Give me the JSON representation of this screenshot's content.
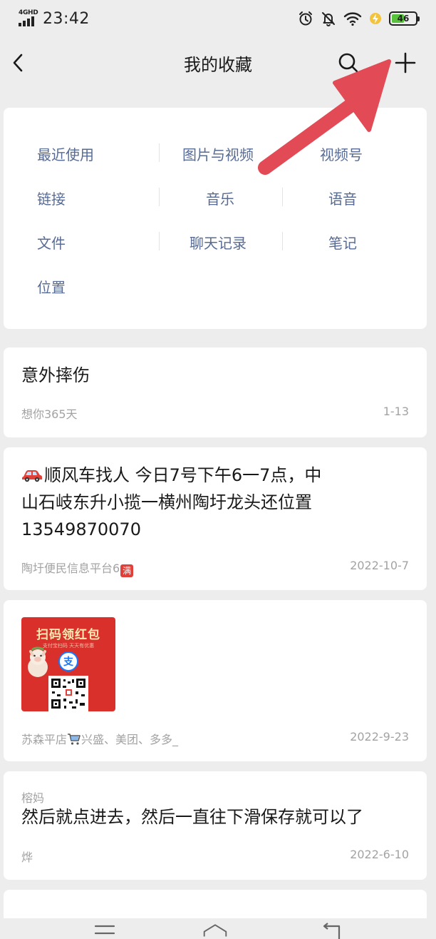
{
  "status_bar": {
    "network": "4GHD",
    "time": "23:42",
    "battery": "46",
    "battery_level": 0.46,
    "icons": [
      "alarm-icon",
      "mute-bell-icon",
      "wifi-icon",
      "charging-icon",
      "battery-icon"
    ]
  },
  "nav": {
    "title": "我的收藏",
    "back_icon": "chevron-left-icon",
    "search_icon": "search-icon",
    "add_icon": "plus-icon"
  },
  "categories": [
    "最近使用",
    "图片与视频",
    "视频号",
    "链接",
    "音乐",
    "语音",
    "文件",
    "聊天记录",
    "笔记",
    "位置"
  ],
  "favorites": [
    {
      "title": "意外摔伤",
      "source": "想你365天",
      "date": "1-13"
    },
    {
      "title_line1": "顺风车找人  今日7号下午6一7点，中",
      "title_line2": "山石岐东升小揽一横州陶圩龙头还位置",
      "title_line3": "13549870070",
      "source": "陶圩便民信息平台6",
      "badge": "满",
      "date": "2022-10-7"
    },
    {
      "image": {
        "title": "扫码领红包",
        "subtitle": "支付宝扫码 天天有优惠",
        "logo": "支"
      },
      "source_part1": "苏森平店",
      "source_part2": "兴盛、美团、多多_",
      "date": "2022-9-23"
    },
    {
      "sender": "榕妈",
      "title": "然后就点进去，然后一直往下滑保存就可以了",
      "source": "烨",
      "date": "2022-6-10"
    }
  ],
  "colors": {
    "background": "#ededed",
    "card": "#ffffff",
    "category_text": "#576b95",
    "meta_text": "#a3a3a3",
    "annotation_arrow": "#e24a55"
  }
}
